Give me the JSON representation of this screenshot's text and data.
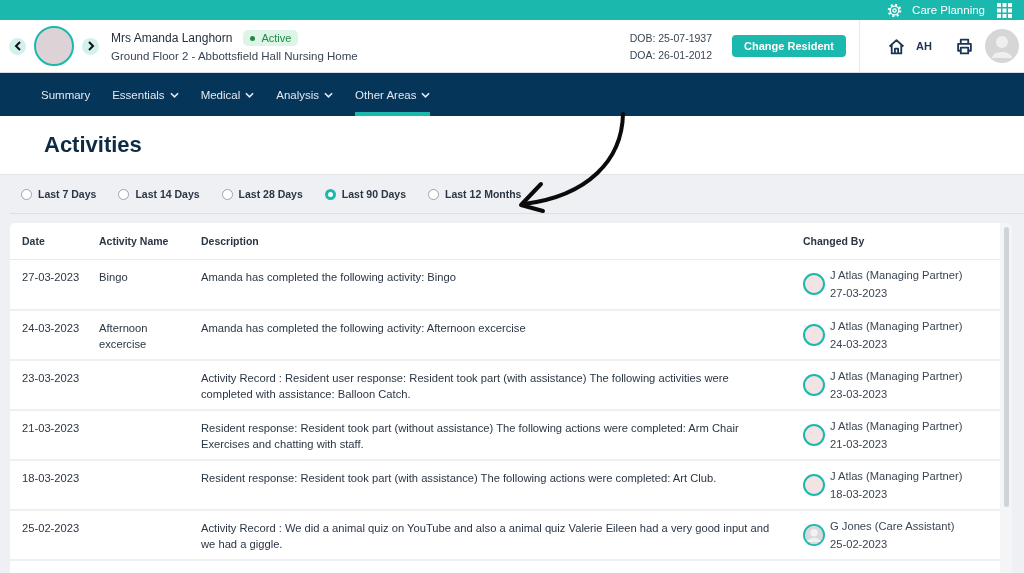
{
  "top_bar": {
    "app_name": "Care Planning"
  },
  "resident": {
    "name": "Mrs Amanda Langhorn",
    "status": "Active",
    "location": "Ground Floor 2 - Abbottsfield Hall Nursing Home",
    "dob": "DOB: 25-07-1937",
    "doa": "DOA: 26-01-2012"
  },
  "change_resident_button": "Change Resident",
  "user": {
    "initials": "AH"
  },
  "nav": [
    {
      "label": "Summary",
      "dropdown": false,
      "selected": false
    },
    {
      "label": "Essentials",
      "dropdown": true,
      "selected": false
    },
    {
      "label": "Medical",
      "dropdown": true,
      "selected": false
    },
    {
      "label": "Analysis",
      "dropdown": true,
      "selected": false
    },
    {
      "label": "Other Areas",
      "dropdown": true,
      "selected": true
    }
  ],
  "page_title": "Activities",
  "filters": [
    {
      "label": "Last 7 Days",
      "selected": false
    },
    {
      "label": "Last 14 Days",
      "selected": false
    },
    {
      "label": "Last 28 Days",
      "selected": false
    },
    {
      "label": "Last 90 Days",
      "selected": true
    },
    {
      "label": "Last 12 Months",
      "selected": false
    }
  ],
  "table": {
    "columns": [
      "Date",
      "Activity Name",
      "Description",
      "Changed By"
    ],
    "rows": [
      {
        "date": "27-03-2023",
        "activity": "Bingo",
        "description": "Amanda has completed the following activity: Bingo",
        "changed_by": "J Atlas (Managing Partner)",
        "changed_on": "27-03-2023",
        "photo_avatar": true
      },
      {
        "date": "24-03-2023",
        "activity": "Afternoon excercise",
        "description": "Amanda has completed the following activity: Afternoon excercise",
        "changed_by": "J Atlas (Managing Partner)",
        "changed_on": "24-03-2023",
        "photo_avatar": true
      },
      {
        "date": "23-03-2023",
        "description": "Activity Record : Resident user response: Resident took part (with assistance) The following activities were completed with assistance: Balloon Catch.",
        "changed_by": "J Atlas (Managing Partner)",
        "changed_on": "23-03-2023",
        "photo_avatar": true
      },
      {
        "date": "21-03-2023",
        "description": "Resident response: Resident took part (without assistance) The following actions were completed: Arm Chair Exercises and chatting with staff.",
        "changed_by": "J Atlas (Managing Partner)",
        "changed_on": "21-03-2023",
        "photo_avatar": true
      },
      {
        "date": "18-03-2023",
        "description": "Resident response: Resident took part (with assistance) The following actions were completed: Art Club.",
        "changed_by": "J Atlas (Managing Partner)",
        "changed_on": "18-03-2023",
        "photo_avatar": true
      },
      {
        "date": "25-02-2023",
        "description": "Activity Record : We did a animal quiz on YouTube and also a animal quiz Valerie Eileen had a very good input and we had a giggle.",
        "changed_by": "G Jones (Care Assistant)",
        "changed_on": "25-02-2023",
        "photo_avatar": false
      }
    ]
  }
}
